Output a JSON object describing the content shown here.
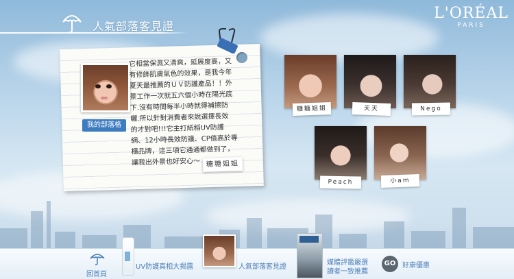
{
  "header": {
    "title": "人氣部落客見證",
    "brand_name": "L'ORÉAL",
    "brand_sub": "PARIS"
  },
  "featured": {
    "blog_button": "我的部落格",
    "testimonial_lines": [
      "它相當保濕又清爽，延展度高，又",
      "有修飾肌膚氣色的效果，是我今年",
      "夏天最推薦的ＵＶ防護產品！！外",
      "景工作一次就五六個小時在陽光底",
      "下.沒有時間每半小時就得補擦防",
      "曬.所以針對消費者來說選擇長效",
      "的才對吧!!!它主打紙稻UV防護",
      "網、12小時長效防護、CP值高於專",
      "櫃品牌，這三項它通通都做到了，",
      "讓我出外景也好安心～"
    ],
    "signature": "糖糖姐姐"
  },
  "bloggers": [
    {
      "name": "糖糖姐姐"
    },
    {
      "name": "天天"
    },
    {
      "name": "Nego"
    },
    {
      "name": "Peach"
    },
    {
      "name": "小am"
    }
  ],
  "nav": {
    "home": "回首頁",
    "uv": "UV防護真相大揭露",
    "bloggers": "人氣部落客見證",
    "media_line1": "媒體評鑑嚴選",
    "media_line2": "讀者一致推薦",
    "go_badge": "GO",
    "offers": "好康優惠"
  },
  "colors": {
    "accent": "#3e7cc0",
    "nav_text": "#4f80b8"
  }
}
